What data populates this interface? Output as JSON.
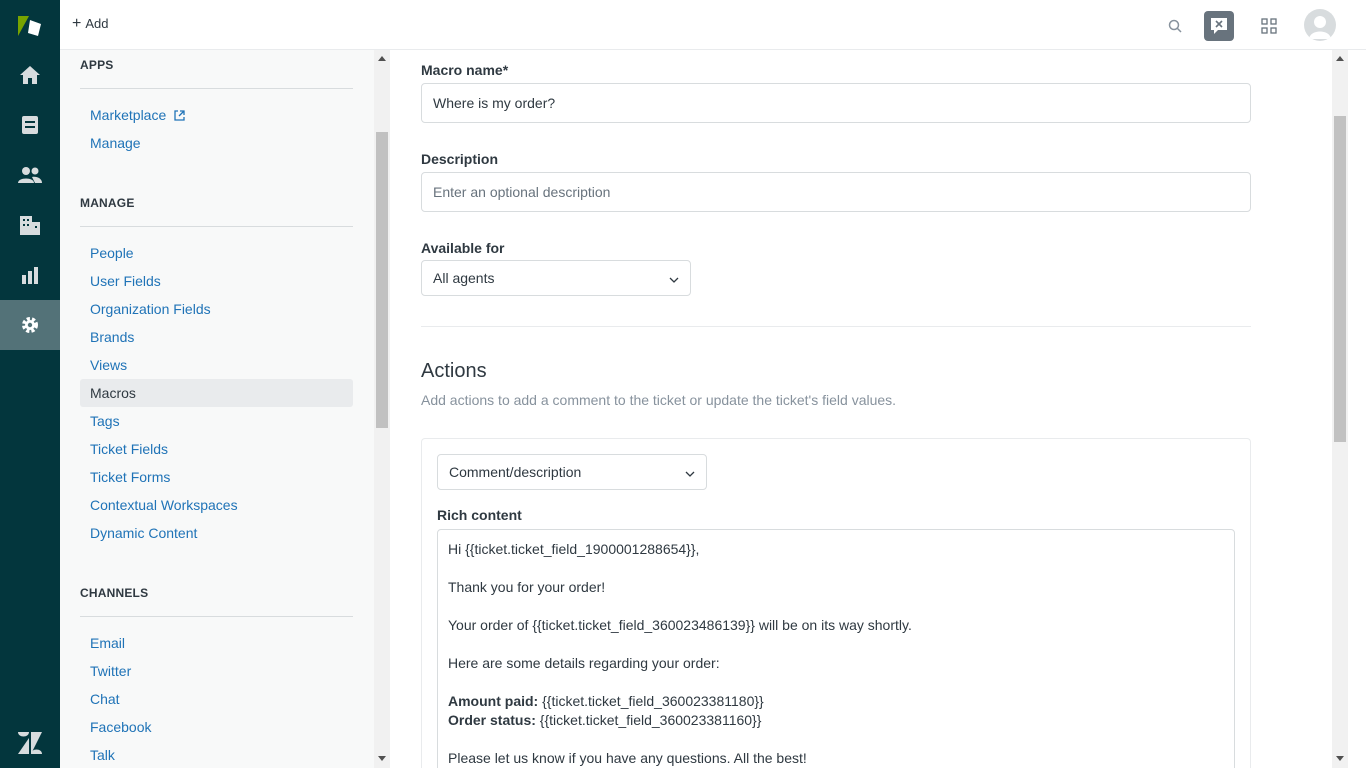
{
  "topbar": {
    "add_label": "Add"
  },
  "rail": {
    "nav": [
      "home-icon",
      "tickets-icon",
      "users-icon",
      "organizations-icon",
      "reporting-icon",
      "admin-gear-icon"
    ],
    "active_index": 5
  },
  "sidebar": {
    "apps": {
      "heading": "APPS",
      "items": [
        "Marketplace",
        "Manage"
      ]
    },
    "manage": {
      "heading": "MANAGE",
      "items": [
        "People",
        "User Fields",
        "Organization Fields",
        "Brands",
        "Views",
        "Macros",
        "Tags",
        "Ticket Fields",
        "Ticket Forms",
        "Contextual Workspaces",
        "Dynamic Content"
      ],
      "selected": "Macros"
    },
    "channels": {
      "heading": "CHANNELS",
      "items": [
        "Email",
        "Twitter",
        "Chat",
        "Facebook",
        "Talk"
      ]
    }
  },
  "form": {
    "macro_name_label": "Macro name*",
    "macro_name_value": "Where is my order?",
    "description_label": "Description",
    "description_placeholder": "Enter an optional description",
    "available_for_label": "Available for",
    "available_for_value": "All agents"
  },
  "actions": {
    "heading": "Actions",
    "subtext": "Add actions to add a comment to the ticket or update the ticket's field values.",
    "action_type": "Comment/description",
    "rich_content_label": "Rich content",
    "editor": {
      "line1": "Hi {{ticket.ticket_field_1900001288654}},",
      "line2": "Thank you for your order!",
      "line3": "Your order of {{ticket.ticket_field_360023486139}} will be on its way shortly.",
      "line4": "Here are some details regarding your order:",
      "amount_label": "Amount paid:",
      "amount_value": " {{ticket.ticket_field_360023381180}}",
      "status_label": "Order status:",
      "status_value": " {{ticket.ticket_field_360023381160}}",
      "line7": "Please let us know if you have any questions. All the best!"
    }
  },
  "colors": {
    "rail": "#03363d",
    "rail_active": "#537278",
    "link": "#1f73b7"
  }
}
